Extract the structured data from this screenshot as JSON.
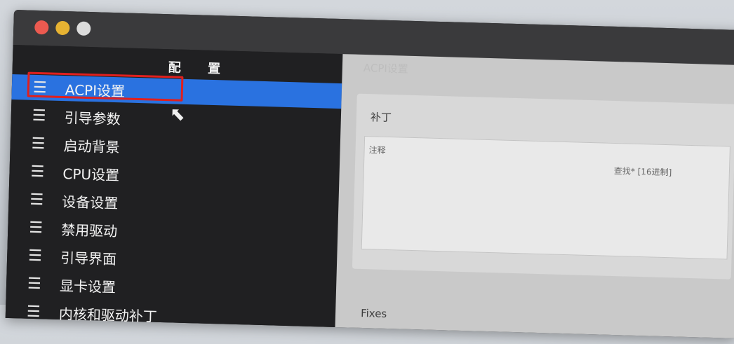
{
  "window": {
    "traffic_lights": {
      "close": "#ec5a50",
      "minimize": "#e6b232",
      "maximize": "#dcdcdc"
    }
  },
  "sidebar": {
    "title": "配 置",
    "items": [
      {
        "label": "ACPI设置",
        "icon": "list-icon",
        "selected": true
      },
      {
        "label": "引导参数",
        "icon": "list-icon"
      },
      {
        "label": "启动背景",
        "icon": "list-icon"
      },
      {
        "label": "CPU设置",
        "icon": "list-icon"
      },
      {
        "label": "设备设置",
        "icon": "list-icon"
      },
      {
        "label": "禁用驱动",
        "icon": "list-icon"
      },
      {
        "label": "引导界面",
        "icon": "list-icon"
      },
      {
        "label": "显卡设置",
        "icon": "list-icon"
      },
      {
        "label": "内核和驱动补丁",
        "icon": "list-icon"
      }
    ]
  },
  "content": {
    "header": "ACPI设置",
    "patches": {
      "label": "补丁",
      "columns": {
        "comment": "注释",
        "find": "查找* [16进制]"
      }
    },
    "fixes_label": "Fixes"
  },
  "colors": {
    "selection": "#2a72e0",
    "highlight_box": "#e0201e"
  }
}
